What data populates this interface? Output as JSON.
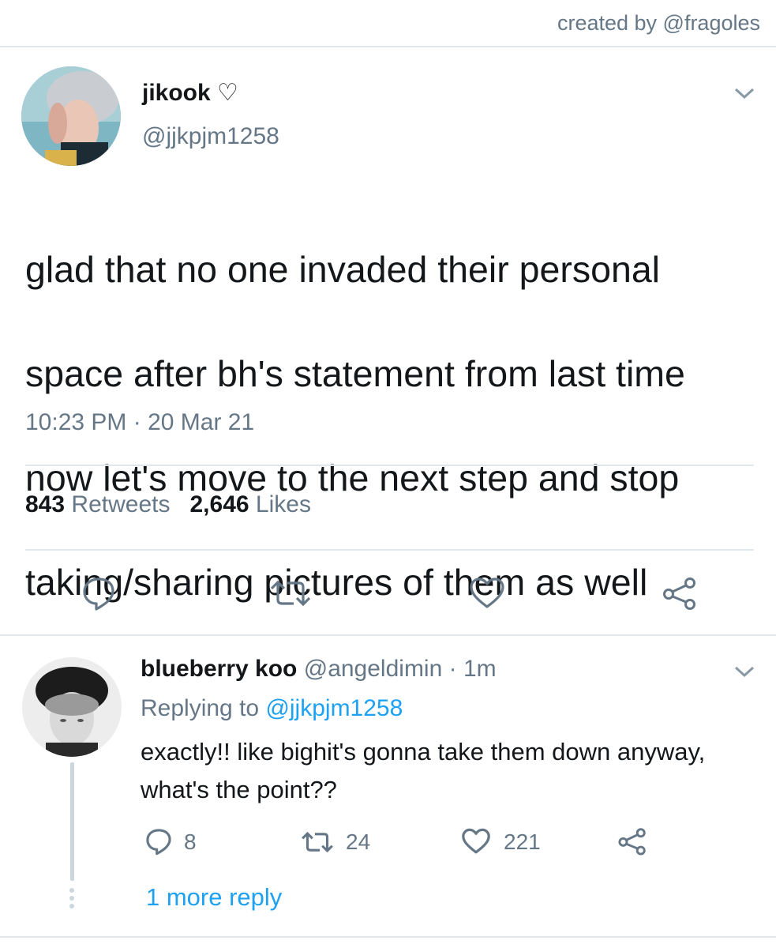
{
  "credit": "created by @fragoles",
  "tweet": {
    "name": "jikook ♡",
    "handle": "@jjkpjm1258",
    "text_lines": [
      "glad that no one invaded their personal",
      "space after bh's statement from last time",
      "now let's move to the next step and stop",
      "taking/sharing pictures of them as well"
    ],
    "timestamp": "10:23 PM · 20 Mar 21",
    "retweets_count": "843",
    "retweets_label": "Retweets",
    "likes_count": "2,646",
    "likes_label": "Likes"
  },
  "reply": {
    "name": "blueberry koo",
    "handle_time": "@angeldimin · 1m",
    "replying_prefix": "Replying to",
    "replying_handle": "@jjkpjm1258",
    "text": "exactly!! like bighit's gonna take them down anyway, what's the point??",
    "reply_count": "8",
    "retweet_count": "24",
    "like_count": "221",
    "more_replies": "1 more reply"
  },
  "colors": {
    "text": "#14171a",
    "secondary": "#657786",
    "link": "#1da1f2",
    "divider": "#e1e8ed"
  }
}
